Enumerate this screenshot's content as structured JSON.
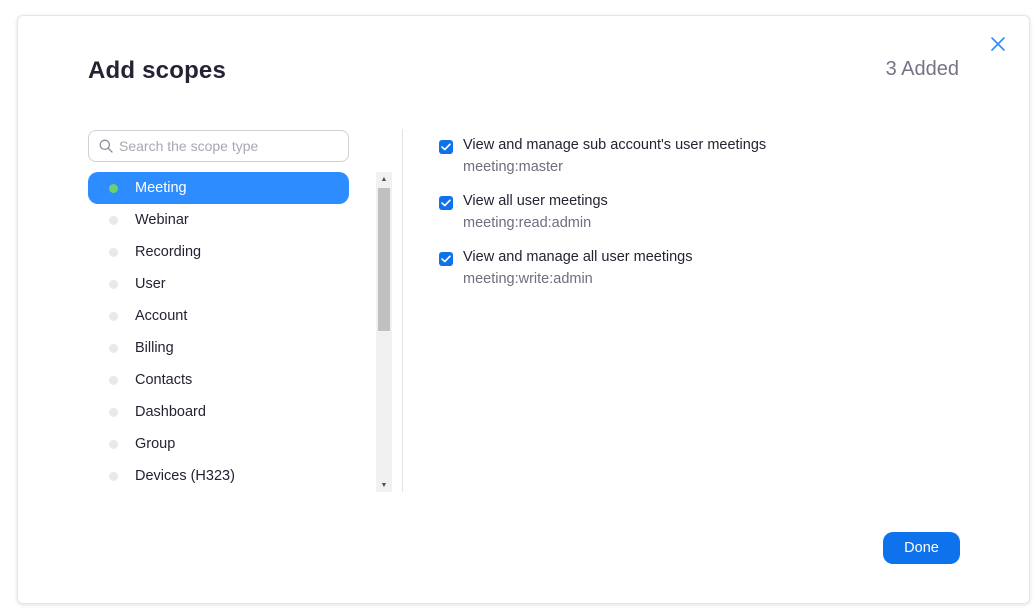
{
  "dialog": {
    "title": "Add scopes",
    "added_count": "3 Added",
    "done_label": "Done"
  },
  "search": {
    "placeholder": "Search the scope type",
    "value": ""
  },
  "scope_types": [
    {
      "label": "Meeting",
      "selected": true
    },
    {
      "label": "Webinar",
      "selected": false
    },
    {
      "label": "Recording",
      "selected": false
    },
    {
      "label": "User",
      "selected": false
    },
    {
      "label": "Account",
      "selected": false
    },
    {
      "label": "Billing",
      "selected": false
    },
    {
      "label": "Contacts",
      "selected": false
    },
    {
      "label": "Dashboard",
      "selected": false
    },
    {
      "label": "Group",
      "selected": false
    },
    {
      "label": "Devices (H323)",
      "selected": false
    }
  ],
  "scopes": [
    {
      "description": "View and manage sub account's user meetings",
      "code": "meeting:master",
      "checked": true
    },
    {
      "description": "View all user meetings",
      "code": "meeting:read:admin",
      "checked": true
    },
    {
      "description": "View and manage all user meetings",
      "code": "meeting:write:admin",
      "checked": true
    }
  ],
  "colors": {
    "accent": "#0e72ed",
    "selected_item": "#2d8cff",
    "active_dot": "#6bd16f"
  },
  "icons": {
    "close": "close-icon",
    "search": "search-icon",
    "check": "checkmark-icon"
  }
}
